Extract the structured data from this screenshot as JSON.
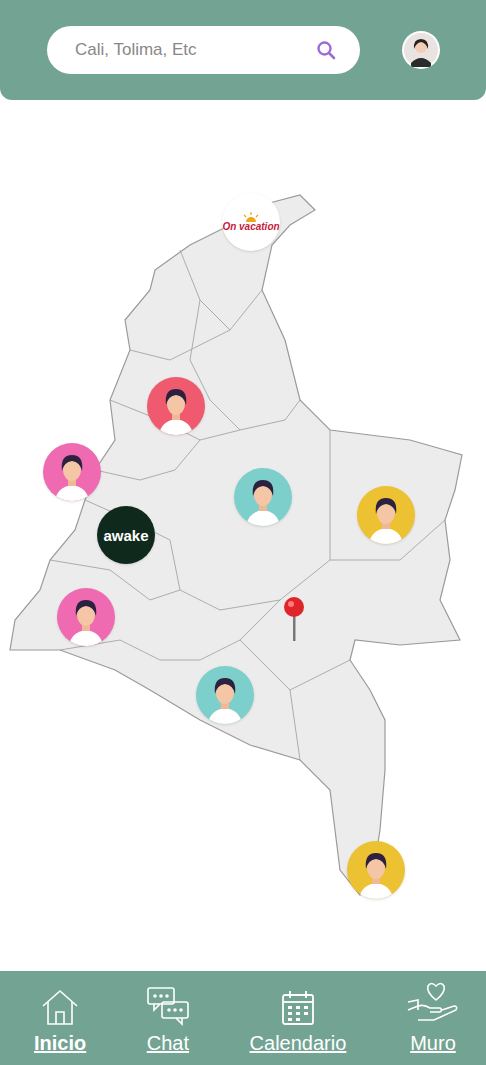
{
  "search": {
    "placeholder": "Cali, Tolima, Etc"
  },
  "map": {
    "markers": [
      {
        "kind": "logo",
        "label": "On vacation",
        "color": "#ffffff"
      },
      {
        "kind": "avatar",
        "color": "#ef5a6f"
      },
      {
        "kind": "avatar",
        "color": "#ef6ab1"
      },
      {
        "kind": "logo",
        "label": "awake",
        "color": "#0f2a1c"
      },
      {
        "kind": "avatar",
        "color": "#7dcfcb"
      },
      {
        "kind": "avatar",
        "color": "#ecc132"
      },
      {
        "kind": "avatar",
        "color": "#ef6ab1"
      },
      {
        "kind": "avatar",
        "color": "#7dcfcb"
      },
      {
        "kind": "avatar",
        "color": "#ecc132"
      }
    ]
  },
  "nav": [
    {
      "label": "Inicio",
      "selected": true
    },
    {
      "label": "Chat",
      "selected": false
    },
    {
      "label": "Calendario",
      "selected": false
    },
    {
      "label": "Muro",
      "selected": false
    }
  ]
}
